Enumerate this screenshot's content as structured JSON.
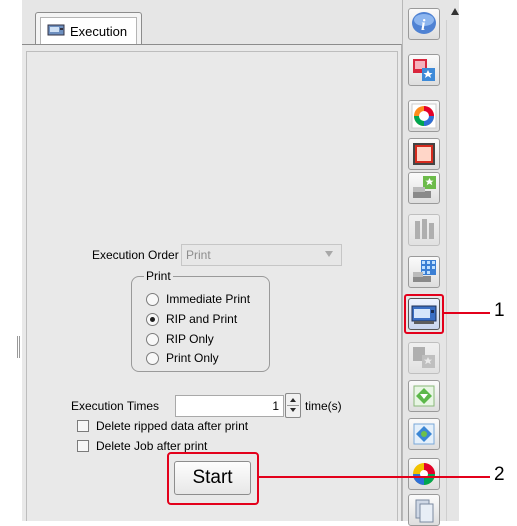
{
  "tab": {
    "label": "Execution"
  },
  "execution_order": {
    "label": "Execution Order",
    "value": "Print"
  },
  "print_group": {
    "title": "Print",
    "options": [
      {
        "label": "Immediate Print",
        "selected": false
      },
      {
        "label": "RIP and Print",
        "selected": true
      },
      {
        "label": "RIP Only",
        "selected": false
      },
      {
        "label": "Print Only",
        "selected": false
      }
    ]
  },
  "execution_times": {
    "label": "Execution Times",
    "value": "1",
    "unit": "time(s)"
  },
  "checkboxes": [
    {
      "label": "Delete ripped data after print",
      "checked": false
    },
    {
      "label": "Delete Job after print",
      "checked": false
    }
  ],
  "start_button": {
    "label": "Start"
  },
  "toolbar": {
    "tools": [
      {
        "icon": "info-icon"
      },
      {
        "icon": "job-properties-icon"
      },
      {
        "icon": "quality-icon"
      },
      {
        "icon": "crop-icon"
      },
      {
        "icon": "media-feed-icon"
      },
      {
        "icon": "cut-icon"
      },
      {
        "icon": "pattern-icon"
      },
      {
        "icon": "printer-execution-icon",
        "active": true
      },
      {
        "icon": "composite-icon"
      },
      {
        "icon": "download-icon"
      },
      {
        "icon": "transfer-icon"
      },
      {
        "icon": "color-wheel-icon"
      },
      {
        "icon": "document-icon"
      }
    ]
  },
  "callouts": [
    {
      "number": "1"
    },
    {
      "number": "2"
    }
  ],
  "colors": {
    "highlight": "#e3001b",
    "panel": "#e9e9e9"
  }
}
